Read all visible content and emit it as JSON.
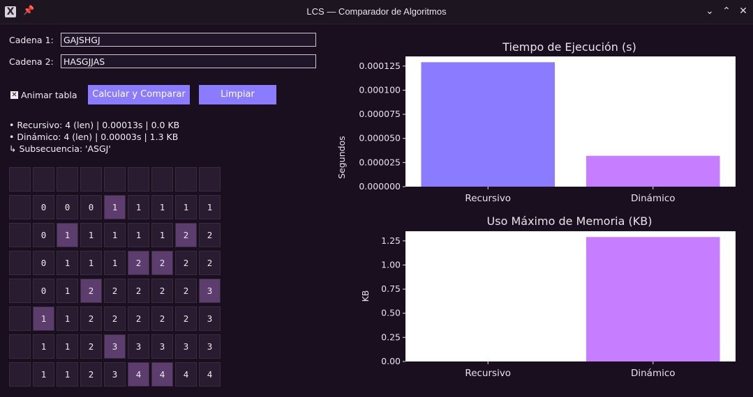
{
  "window": {
    "title": "LCS — Comparador de Algoritmos",
    "app_icon_glyph": "X",
    "pin_glyph": "📌",
    "controls": [
      "⌄",
      "⌃",
      "✕"
    ]
  },
  "inputs": {
    "cadena1_label": "Cadena 1:",
    "cadena1_value": "GAJSHGJ",
    "cadena2_label": "Cadena 2:",
    "cadena2_value": "HASGJJAS"
  },
  "controls": {
    "animate_label": "Animar tabla",
    "animate_checked": true,
    "calc_button": "Calcular y Comparar",
    "clear_button": "Limpiar"
  },
  "results": {
    "recursive": "• Recursivo: 4 (len) | 0.00013s | 0.0 KB",
    "dynamic": "• Dinámico: 4 (len) | 0.00003s | 1.3 KB",
    "subsequence": "↳ Subsecuencia: 'ASGJ'"
  },
  "table": {
    "rows": [
      [
        "",
        "",
        "",
        "",
        "",
        "",
        "",
        "",
        ""
      ],
      [
        "",
        "0",
        "0",
        "0",
        "1",
        "1",
        "1",
        "1",
        "1"
      ],
      [
        "",
        "0",
        "1",
        "1",
        "1",
        "1",
        "1",
        "2",
        "2"
      ],
      [
        "",
        "0",
        "1",
        "1",
        "1",
        "2",
        "2",
        "2",
        "2"
      ],
      [
        "",
        "0",
        "1",
        "2",
        "2",
        "2",
        "2",
        "2",
        "3"
      ],
      [
        "",
        "1",
        "1",
        "2",
        "2",
        "2",
        "2",
        "2",
        "3"
      ],
      [
        "",
        "1",
        "1",
        "2",
        "3",
        "3",
        "3",
        "3",
        "3"
      ],
      [
        "",
        "1",
        "1",
        "2",
        "3",
        "4",
        "4",
        "4",
        "4"
      ]
    ],
    "highlighted": [
      [
        1,
        4
      ],
      [
        2,
        2
      ],
      [
        2,
        7
      ],
      [
        3,
        5
      ],
      [
        3,
        6
      ],
      [
        4,
        3
      ],
      [
        4,
        8
      ],
      [
        5,
        1
      ],
      [
        6,
        4
      ],
      [
        7,
        5
      ],
      [
        7,
        6
      ]
    ],
    "highlight_color": "#5c3d6e"
  },
  "chart_data": [
    {
      "type": "bar",
      "title": "Tiempo de Ejecución (s)",
      "ylabel": "Segundos",
      "xlabel": "",
      "categories": [
        "Recursivo",
        "Dinámico"
      ],
      "values": [
        0.000129,
        3.2e-05
      ],
      "colors": [
        "#8b7bff",
        "#c77dff"
      ],
      "ylim": [
        0,
        0.000135
      ],
      "yticks": [
        0,
        2.5e-05,
        5e-05,
        7.5e-05,
        0.0001,
        0.000125
      ],
      "ytick_labels": [
        "0.000000",
        "0.000025",
        "0.000050",
        "0.000075",
        "0.000100",
        "0.000125"
      ],
      "grid": false
    },
    {
      "type": "bar",
      "title": "Uso Máximo de Memoria (KB)",
      "ylabel": "KB",
      "xlabel": "",
      "categories": [
        "Recursivo",
        "Dinámico"
      ],
      "values": [
        0.0,
        1.29
      ],
      "colors": [
        "#8b7bff",
        "#c77dff"
      ],
      "ylim": [
        0,
        1.35
      ],
      "yticks": [
        0,
        0.25,
        0.5,
        0.75,
        1.0,
        1.25
      ],
      "ytick_labels": [
        "0.00",
        "0.25",
        "0.50",
        "0.75",
        "1.00",
        "1.25"
      ],
      "grid": false
    }
  ]
}
